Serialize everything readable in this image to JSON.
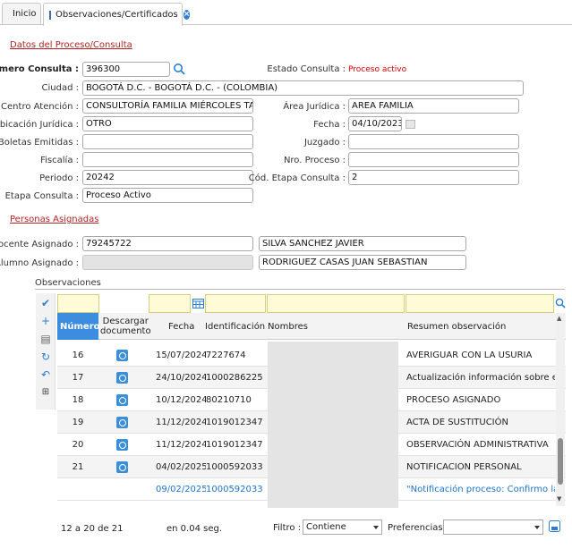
{
  "tabs": [
    {
      "label": "Inicio"
    },
    {
      "label": "Observaciones/Certificados"
    }
  ],
  "sections": {
    "proceso": "Datos del Proceso/Consulta",
    "personas": "Personas Asignadas"
  },
  "form": {
    "numero_consulta_label": "Número Consulta :",
    "numero_consulta": "396300",
    "estado_consulta_label": "Estado Consulta :",
    "estado_consulta": "Proceso activo",
    "ciudad_label": "Ciudad :",
    "ciudad": "BOGOTÁ D.C. - BOGOTÁ D.C. - (COLOMBIA)",
    "centro_label": "Centro Atención :",
    "centro": "CONSULTORÍA FAMILIA MIÉRCOLES TARDE",
    "area_label": "Área Jurídica :",
    "area": "AREA FAMILIA",
    "ubicacion_label": "Ubicación Jurídica :",
    "ubicacion": "OTRO",
    "fecha_label": "Fecha :",
    "fecha": "04/10/2023",
    "boletas_label": "Boletas Emitidas :",
    "boletas": "",
    "juzgado_label": "Juzgado :",
    "juzgado": "",
    "fiscalia_label": "Fiscalía :",
    "fiscalia": "",
    "nro_proceso_label": "Nro. Proceso :",
    "nro_proceso": "",
    "periodo_label": "Periodo :",
    "periodo": "20242",
    "cod_etapa_label": "Cód. Etapa Consulta :",
    "cod_etapa": "2",
    "etapa_label": "Etapa Consulta :",
    "etapa": "Proceso Activo"
  },
  "personas": {
    "docente_label": "Docente Asignado :",
    "docente_id": "79245722",
    "docente_nombre": "SILVA SANCHEZ JAVIER",
    "alumno_label": "Alumno Asignado :",
    "alumno_id": "",
    "alumno_nombre": "RODRIGUEZ CASAS JUAN SEBASTIAN"
  },
  "grid": {
    "title": "Observaciones",
    "headers": {
      "numero": "Número",
      "descargar": "Descargar documento",
      "fecha": "Fecha",
      "identificacion": "Identificación",
      "nombres": "Nombres",
      "resumen": "Resumen observación"
    },
    "rows": [
      {
        "numero": "16",
        "fecha": "15/07/2024",
        "id": "7227674",
        "resumen": "AVERIGUAR CON LA USURIA",
        "alt": false
      },
      {
        "numero": "17",
        "fecha": "24/10/2024",
        "id": "1000286225",
        "resumen": "Actualización información sobre el ca",
        "alt": true
      },
      {
        "numero": "18",
        "fecha": "10/12/2024",
        "id": "80210710",
        "resumen": "PROCESO ASIGNADO",
        "alt": false
      },
      {
        "numero": "19",
        "fecha": "11/12/2024",
        "id": "1019012347",
        "resumen": "ACTA DE SUSTITUCIÓN",
        "alt": true
      },
      {
        "numero": "20",
        "fecha": "11/12/2024",
        "id": "1019012347",
        "resumen": "OBSERVACIÓN ADMINISTRATIVA",
        "alt": false
      },
      {
        "numero": "21",
        "fecha": "04/02/2025",
        "id": "1000592033",
        "resumen": "NOTIFICACION PERSONAL",
        "alt": true
      },
      {
        "numero": "",
        "fecha": "09/02/2025",
        "id": "1000592033",
        "resumen": "\"Notificación proceso: Confirmo la rec",
        "alt": false,
        "blue": true
      }
    ],
    "footer": {
      "range": "12 a 20 de 21",
      "time": "en 0.04 seg.",
      "filtro_label": "Filtro :",
      "filtro_value": "Contiene",
      "preferencias_label": "Preferencias :",
      "preferencias_value": ""
    }
  },
  "icons": {
    "check": "check-icon",
    "add": "plus-icon",
    "doc": "document-icon",
    "refresh": "refresh-icon",
    "undo": "undo-icon",
    "export": "excel-icon",
    "search": "search-icon",
    "calendar": "calendar-icon"
  },
  "colors": {
    "accent": "#3c8de0",
    "section": "#b22222",
    "status": "#e00000"
  }
}
